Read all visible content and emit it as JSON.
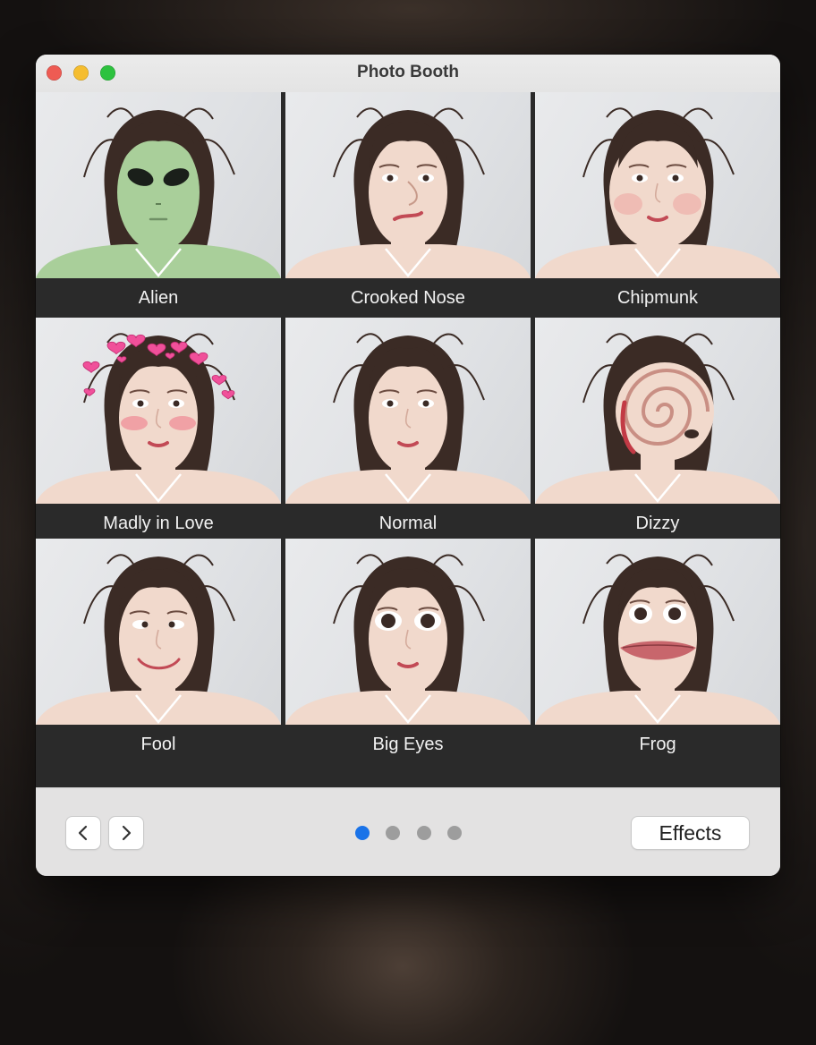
{
  "window": {
    "title": "Photo Booth"
  },
  "effects": [
    {
      "label": "Alien",
      "variant": "alien"
    },
    {
      "label": "Crooked Nose",
      "variant": "crooked"
    },
    {
      "label": "Chipmunk",
      "variant": "chipmunk"
    },
    {
      "label": "Madly in Love",
      "variant": "love"
    },
    {
      "label": "Normal",
      "variant": "normal"
    },
    {
      "label": "Dizzy",
      "variant": "dizzy"
    },
    {
      "label": "Fool",
      "variant": "fool"
    },
    {
      "label": "Big Eyes",
      "variant": "bigeyes"
    },
    {
      "label": "Frog",
      "variant": "frog"
    }
  ],
  "toolbar": {
    "effects_label": "Effects",
    "prev_icon": "chevron-left-icon",
    "next_icon": "chevron-right-icon"
  },
  "pagination": {
    "pages": 4,
    "current": 1
  },
  "colors": {
    "accent": "#1a73e8",
    "alien_skin": "#a9cf9a",
    "skin": "#f1d9cc",
    "hair": "#3b2b25"
  }
}
